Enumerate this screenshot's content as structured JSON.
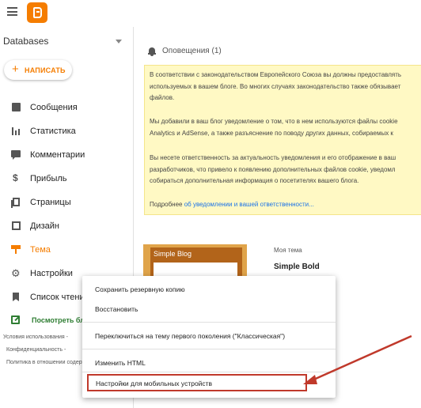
{
  "sidebar": {
    "blog_name": "Databases",
    "new_post_label": "НАПИСАТЬ",
    "items": [
      {
        "label": "Сообщения"
      },
      {
        "label": "Статистика"
      },
      {
        "label": "Комментарии"
      },
      {
        "label": "Прибыль"
      },
      {
        "label": "Страницы"
      },
      {
        "label": "Дизайн"
      },
      {
        "label": "Тема"
      },
      {
        "label": "Настройки"
      },
      {
        "label": "Список чтения"
      }
    ],
    "active_item": "Тема",
    "view_blog_label": "Посмотреть блог",
    "footer_links": [
      "Условия использования -",
      "Конфиденциальность -",
      "Политика в отношении содержания"
    ]
  },
  "notifications": {
    "title": "Оповещения (1)",
    "lines": [
      "В соответствии с законодательством Европейского Союза вы должны предоставлять",
      "используемых в вашем блоге. Во многих случаях законодательство также обязывает",
      "файлов.",
      "Мы добавили в ваш блог уведомление о том, что в нем используются файлы cookie",
      "Analytics и AdSense, а также разъяснение по поводу других данных, собираемых к",
      "Вы несете ответственность за актуальность уведомления и его отображение в ваш",
      "разработчиков, что привело к появлению дополнительных файлов cookie, уведомл",
      "собираться дополнительная информация о посетителях вашего блога."
    ],
    "more_prefix": "Подробнее ",
    "more_link": "об уведомлении и вашей ответственности..."
  },
  "theme": {
    "section_label": "Моя тема",
    "name": "Simple Bold",
    "thumbnail_title": "Simple Blog"
  },
  "menu": {
    "items": [
      "Сохранить резервную копию",
      "Восстановить",
      "Переключиться на тему первого поколения (\"Классическая\")",
      "Изменить HTML",
      "Настройки для мобильных устройств"
    ],
    "highlighted": "Настройки для мобильных устройств"
  },
  "colors": {
    "brand": "#f57d00",
    "notice_bg": "#fff9c4",
    "highlight": "#c0392b",
    "view_blog": "#2e7d32"
  }
}
